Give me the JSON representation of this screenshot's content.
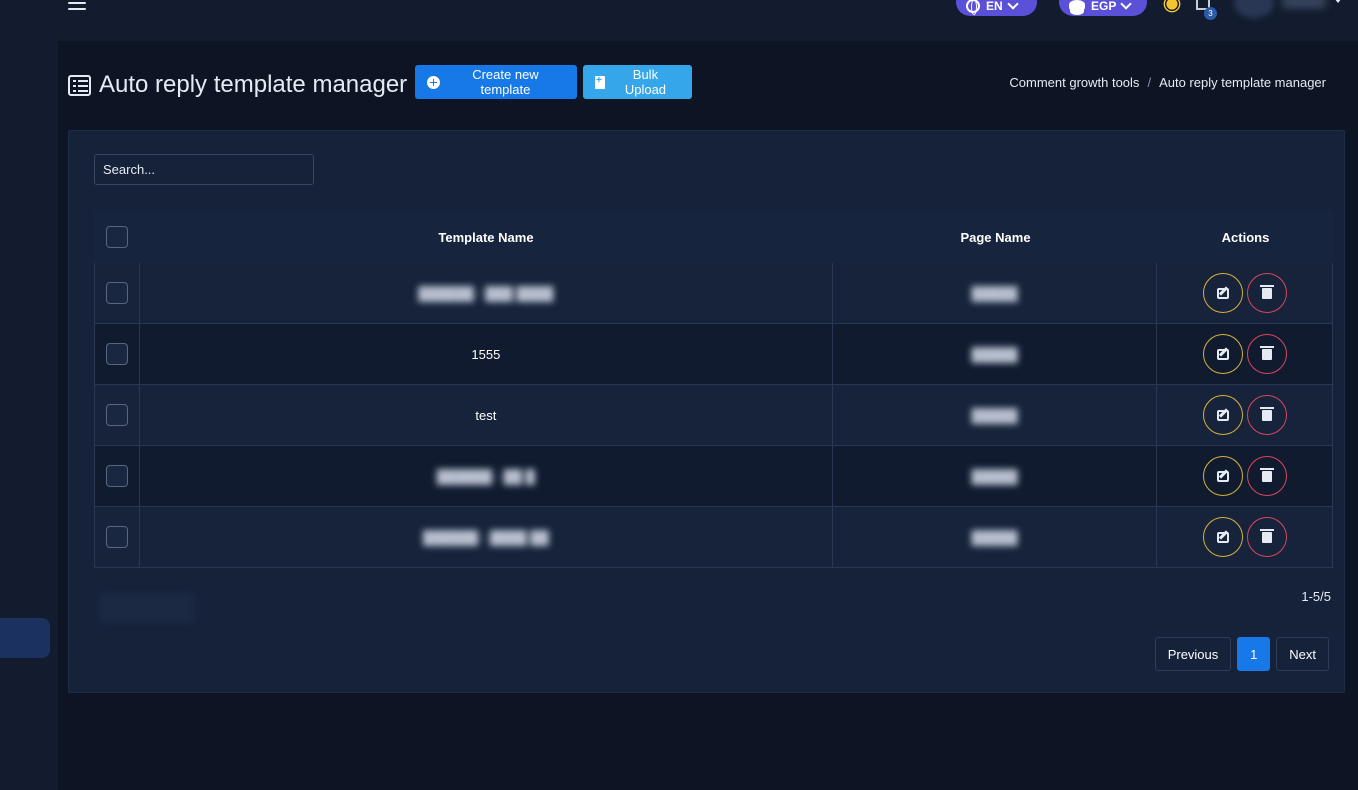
{
  "topbar": {
    "language": "EN",
    "currency": "EGP",
    "notification_count": "3"
  },
  "header": {
    "title": "Auto reply template manager",
    "create_button": "Create new template",
    "bulk_button": "Bulk Upload",
    "breadcrumb": [
      "Comment growth tools",
      "Auto reply template manager"
    ]
  },
  "search": {
    "placeholder": "Search..."
  },
  "table": {
    "columns": [
      "Template Name",
      "Page Name",
      "Actions"
    ],
    "rows": [
      {
        "template": "██████ - ███ ████",
        "page": "█████",
        "blurred": true
      },
      {
        "template": "1555",
        "page": "█████",
        "blurred": false
      },
      {
        "template": "test",
        "page": "█████",
        "blurred": false
      },
      {
        "template": "██████ - ██ █",
        "page": "█████",
        "blurred": true
      },
      {
        "template": "██████ - ████ ██",
        "page": "█████",
        "blurred": true
      }
    ]
  },
  "pagination": {
    "range_text": "1-5/5",
    "previous": "Previous",
    "current_page": "1",
    "next": "Next"
  },
  "colors": {
    "accent": "#1779e8",
    "secondary_accent": "#35a6ea",
    "edit_ring": "#d9b23a",
    "delete_ring": "#d8475f",
    "pill": "#5b51d8"
  }
}
